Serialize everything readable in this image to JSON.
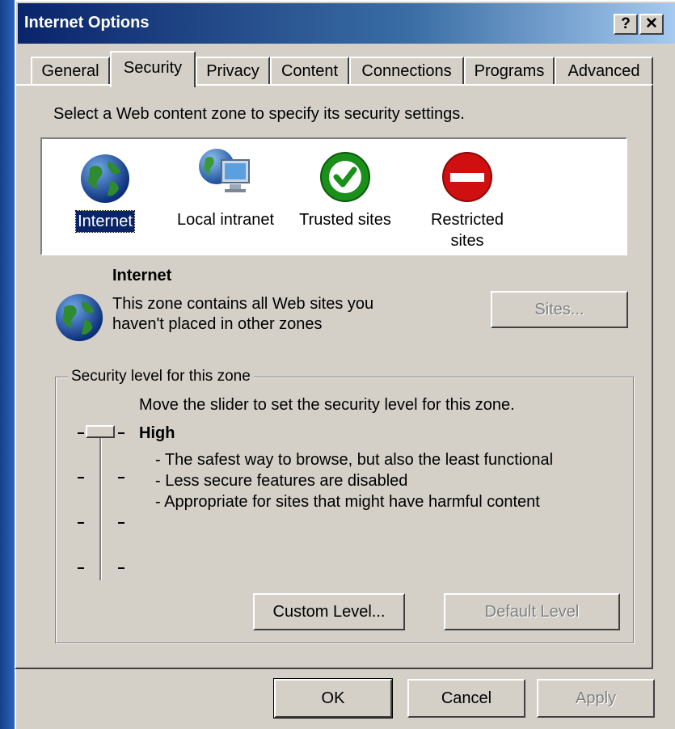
{
  "window": {
    "title": "Internet Options",
    "help_button": "?",
    "close_button": "✕"
  },
  "tabs": [
    {
      "label": "General"
    },
    {
      "label": "Security"
    },
    {
      "label": "Privacy"
    },
    {
      "label": "Content"
    },
    {
      "label": "Connections"
    },
    {
      "label": "Programs"
    },
    {
      "label": "Advanced"
    }
  ],
  "active_tab": "Security",
  "security": {
    "instruction": "Select a Web content zone to specify its security settings.",
    "zones": [
      {
        "label": "Internet",
        "icon": "globe-icon",
        "selected": true
      },
      {
        "label": "Local intranet",
        "icon": "intranet-icon"
      },
      {
        "label": "Trusted sites",
        "icon": "checkmark-icon"
      },
      {
        "label": "Restricted sites",
        "label_line1": "Restricted",
        "label_line2": "sites",
        "icon": "no-entry-icon"
      }
    ],
    "selected_zone": {
      "name": "Internet",
      "desc_line1": "This zone contains all Web sites you",
      "desc_line2": "haven't placed in other zones"
    },
    "sites_button": "Sites...",
    "level_group": {
      "legend": "Security level for this zone",
      "instruction": "Move the slider to set the security level for this zone.",
      "level_name": "High",
      "bullets": [
        "- The safest way to browse, but also the least functional",
        "- Less secure features are disabled",
        "- Appropriate for sites that might have harmful content"
      ],
      "slider_position": "top",
      "custom_level_button": "Custom Level...",
      "default_level_button": "Default Level"
    }
  },
  "footer": {
    "ok": "OK",
    "cancel": "Cancel",
    "apply": "Apply"
  },
  "colors": {
    "title_bar": "#0a246a",
    "dialog_bg": "#d4d0c8",
    "selection": "#0a246a",
    "trusted_green": "#1a8f1a",
    "restricted_red": "#d01010"
  }
}
